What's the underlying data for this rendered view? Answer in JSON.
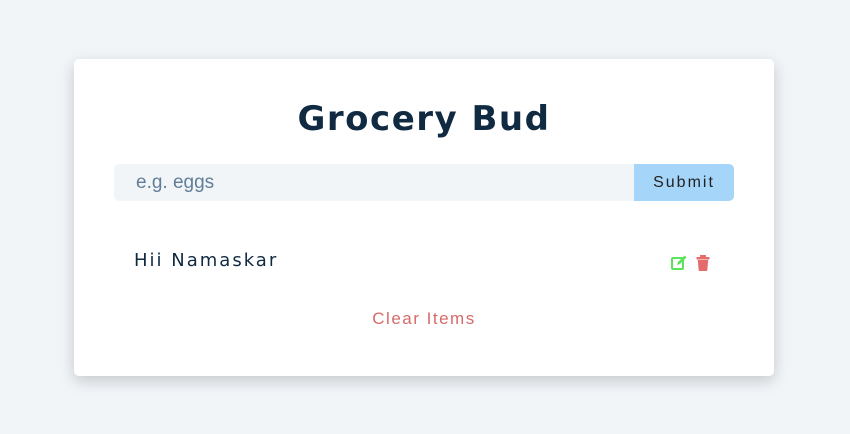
{
  "app": {
    "title": "Grocery Bud"
  },
  "form": {
    "placeholder": "e.g. eggs",
    "value": "",
    "submit_label": "Submit"
  },
  "items": [
    {
      "title": "Hii Namaskar"
    }
  ],
  "actions": {
    "clear_label": "Clear Items"
  },
  "icons": {
    "edit": "edit-icon",
    "delete": "trash-icon"
  },
  "colors": {
    "background": "#f1f5f8",
    "title": "#102a42",
    "submit_bg": "#a5d5f8",
    "edit_icon": "#5ce35c",
    "delete_icon": "#e66b6b",
    "clear_text": "#d66a6a"
  }
}
